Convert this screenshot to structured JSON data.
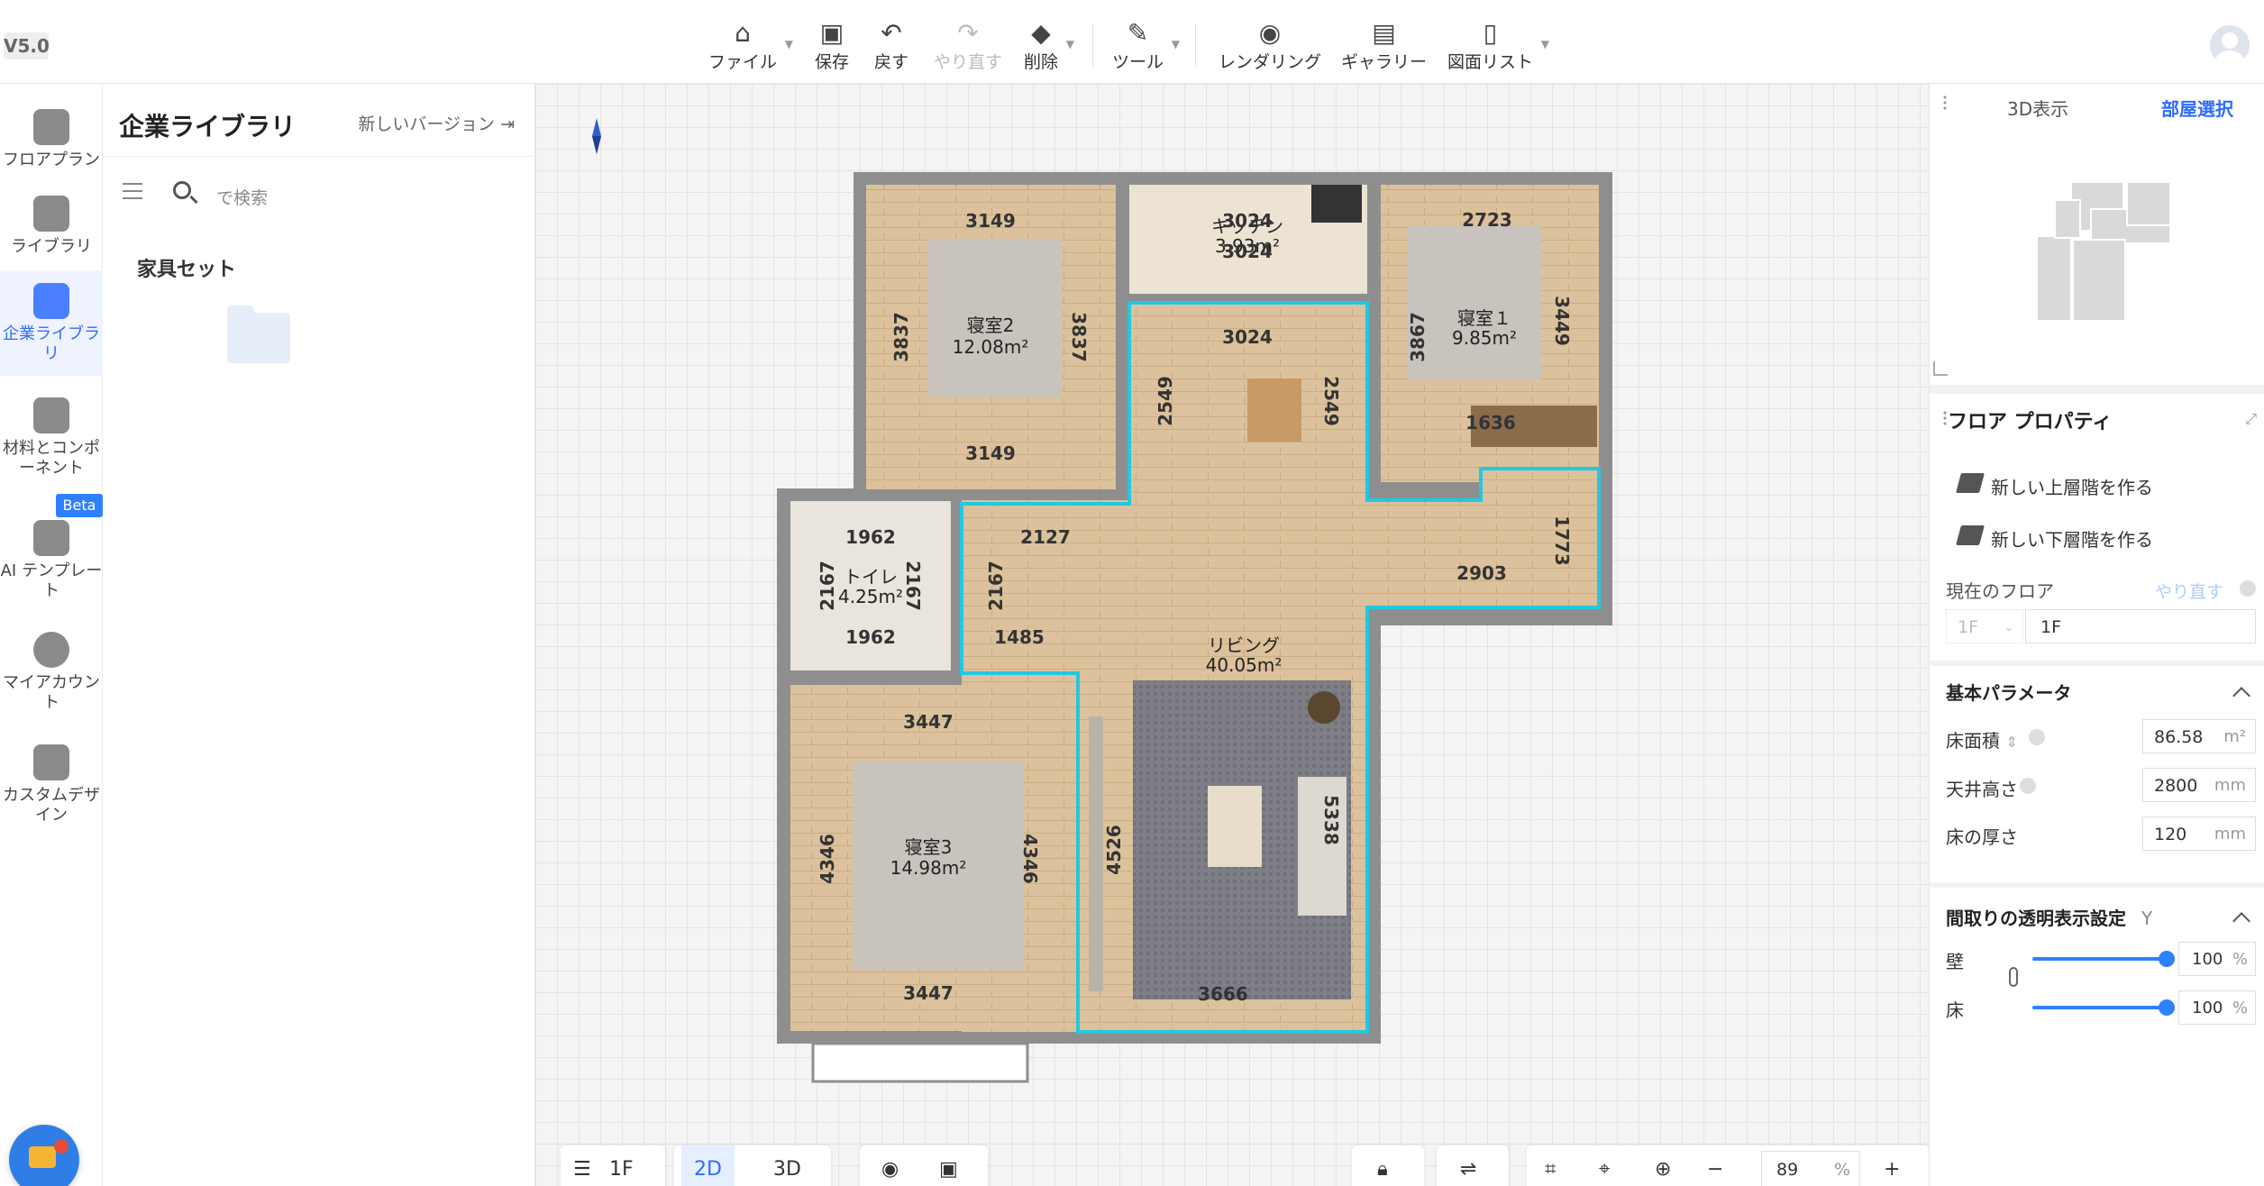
{
  "app": {
    "version": "V5.0"
  },
  "toolbar": {
    "file": "ファイル",
    "save": "保存",
    "undo": "戻す",
    "redo": "やり直す",
    "delete": "削除",
    "tools": "ツール",
    "rendering": "レンダリング",
    "gallery": "ギャラリー",
    "drawing_list": "図面リスト"
  },
  "rail": {
    "items": [
      {
        "label": "フロアプラン",
        "icon": "floorplan-icon"
      },
      {
        "label": "ライブラリ",
        "icon": "sofa-icon"
      },
      {
        "label": "企業ライブラリ",
        "icon": "crown-icon"
      },
      {
        "label": "材料とコンポーネント",
        "icon": "door-icon"
      },
      {
        "label": "AI テンプレート",
        "icon": "template-icon"
      },
      {
        "label": "マイアカウント",
        "icon": "user-icon"
      },
      {
        "label": "カスタムデザイン",
        "icon": "cabinet-icon"
      }
    ],
    "beta": "Beta"
  },
  "library": {
    "title": "企業ライブラリ",
    "new_version": "新しいバージョン",
    "search_placeholder": "で検索",
    "set_title": "家具セット"
  },
  "plan": {
    "rooms": [
      {
        "name": "寝室2",
        "area": "12.08m²"
      },
      {
        "name": "キッチン",
        "area": "3.93m²"
      },
      {
        "name": "寝室１",
        "area": "9.85m²"
      },
      {
        "name": "トイレ",
        "area": "4.25m²"
      },
      {
        "name": "リビング",
        "area": "40.05m²"
      },
      {
        "name": "寝室3",
        "area": "14.98m²"
      }
    ],
    "dims": {
      "b2_top": "3149",
      "b2_bottom": "3149",
      "b2_left": "3837",
      "b2_right": "3837",
      "k_top": "3024",
      "k_bottom": "3024",
      "b1_top": "2723",
      "b1_left": "3867",
      "b1_right": "3449",
      "b1_bottom": "1636",
      "din_top": "3024",
      "din_left": "2549",
      "din_right": "2549",
      "t_top": "1962",
      "t_bottom": "1962",
      "t_left": "2167",
      "t_right": "2167",
      "hall_top": "2127",
      "hall_left": "2167",
      "hall_bottom": "1485",
      "r_top": "2903",
      "r_right": "1773",
      "b3_top": "3447",
      "b3_bottom": "3447",
      "b3_left": "4346",
      "b3_right": "4346",
      "liv_left": "4526",
      "liv_right": "5338",
      "liv_bottom": "3666"
    }
  },
  "canvas_bar": {
    "floor": "1F",
    "mode_2d": "2D",
    "mode_3d": "3D",
    "zoom": "89",
    "zoom_unit": "%"
  },
  "right_panel": {
    "tab_3d": "3D表示",
    "tab_room_select": "部屋選択",
    "floor_props_title": "フロア プロパティ",
    "new_upper": "新しい上層階を作る",
    "new_lower": "新しい下層階を作る",
    "current_floor_label": "現在のフロア",
    "redo": "やり直す",
    "floor_select": "1F",
    "floor_name": "1F",
    "basic_params": "基本パラメータ",
    "floor_area_label": "床面積",
    "floor_area": "86.58",
    "floor_area_unit": "m²",
    "ceiling_label": "天井高さ",
    "ceiling": "2800",
    "thickness_label": "床の厚さ",
    "thickness": "120",
    "mm": "mm",
    "transparency_title": "間取りの透明表示設定",
    "transparency_hint": "Y",
    "wall_label": "壁",
    "wall_value": "100",
    "floor_label": "床",
    "floor_value": "100",
    "percent": "%"
  },
  "colors": {
    "accent": "#2f6bff",
    "selection_outline": "#22c8e0",
    "wall": "#8e8e8e",
    "floor_wood": "#d8bd96"
  }
}
